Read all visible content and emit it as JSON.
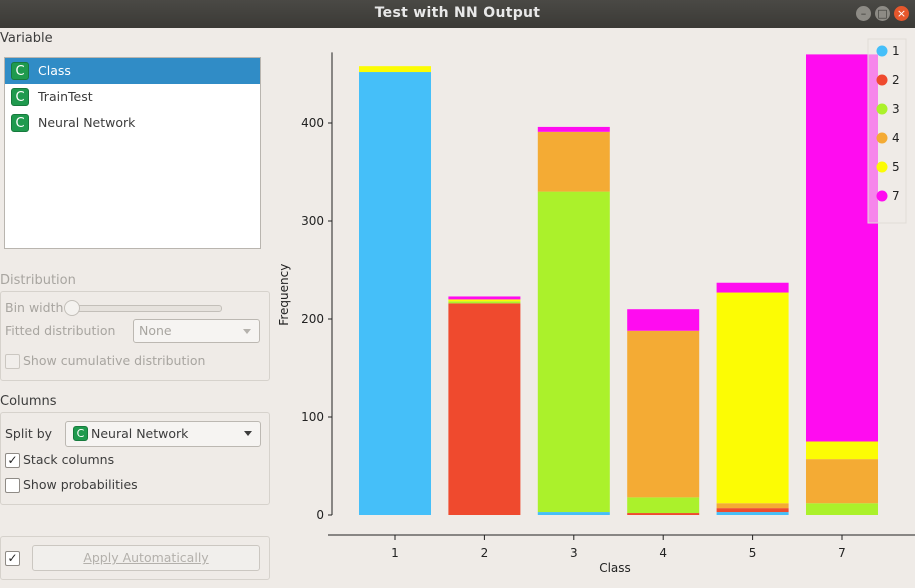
{
  "window": {
    "title": "Test with NN Output"
  },
  "variable": {
    "heading": "Variable",
    "items": [
      {
        "label": "Class",
        "icon": "C",
        "selected": true
      },
      {
        "label": "TrainTest",
        "icon": "C",
        "selected": false
      },
      {
        "label": "Neural Network",
        "icon": "C",
        "selected": false
      }
    ]
  },
  "distribution": {
    "heading": "Distribution",
    "bin_width_label": "Bin width",
    "fitted_label": "Fitted distribution",
    "fitted_value": "None",
    "cumulative_label": "Show cumulative distribution"
  },
  "columns": {
    "heading": "Columns",
    "split_by_label": "Split by",
    "split_by_value": "Neural Network",
    "split_by_icon": "C",
    "stack_label": "Stack columns",
    "stack_checked": true,
    "prob_label": "Show probabilities",
    "prob_checked": false
  },
  "footer": {
    "auto_checked": true,
    "apply_label": "Apply Automatically"
  },
  "chart_data": {
    "type": "bar",
    "stacked": true,
    "xlabel": "Class",
    "ylabel": "Frequency",
    "categories": [
      "1",
      "2",
      "3",
      "4",
      "5",
      "7"
    ],
    "ylim": [
      0,
      470
    ],
    "yticks": [
      0,
      100,
      200,
      300,
      400
    ],
    "legend_position": "top-right",
    "series": [
      {
        "name": "1",
        "color": "#45bff9",
        "values": [
          452,
          0,
          3,
          0,
          3,
          0
        ]
      },
      {
        "name": "2",
        "color": "#ef4a2e",
        "values": [
          0,
          216,
          0,
          2,
          4,
          0
        ]
      },
      {
        "name": "3",
        "color": "#abf12b",
        "values": [
          0,
          2,
          327,
          16,
          0,
          12
        ]
      },
      {
        "name": "4",
        "color": "#f4ab34",
        "values": [
          0,
          0,
          61,
          170,
          5,
          45
        ]
      },
      {
        "name": "5",
        "color": "#fcfc04",
        "values": [
          6,
          2,
          0,
          0,
          215,
          18
        ]
      },
      {
        "name": "7",
        "color": "#ff0cf0",
        "values": [
          0,
          3,
          5,
          22,
          10,
          395
        ]
      }
    ]
  }
}
